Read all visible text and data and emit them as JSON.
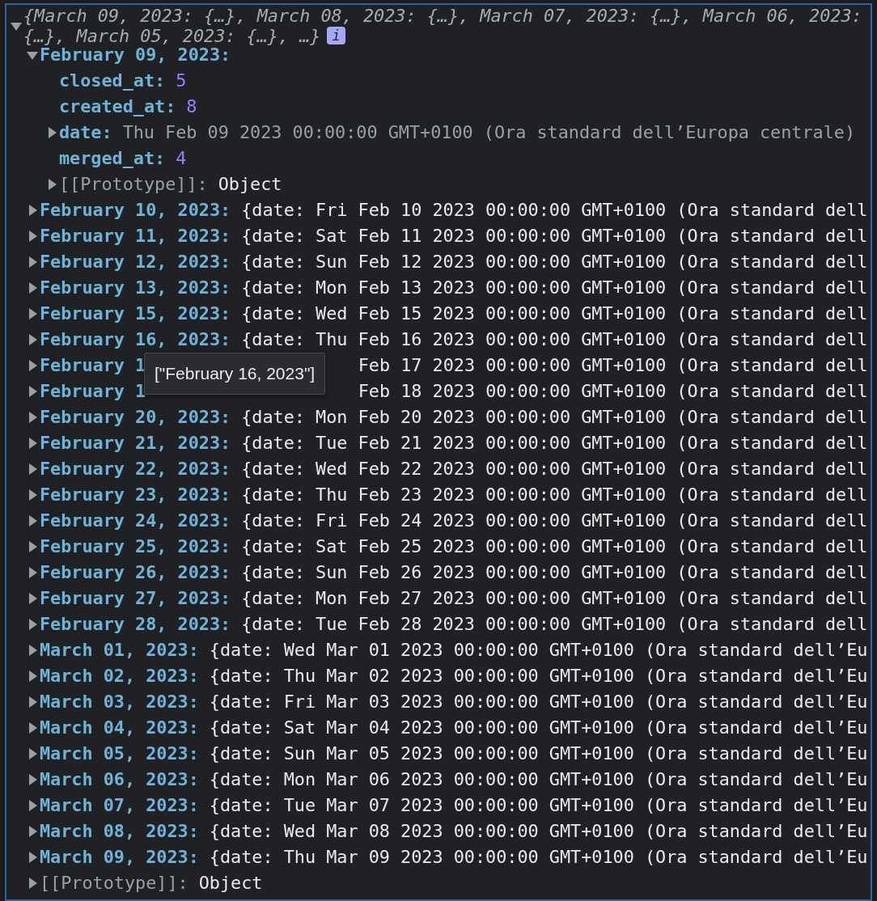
{
  "root": {
    "expanded": true,
    "summary_lines": [
      "{March 09, 2023: {…}, March 08, 2023: {…}, March 07, 2023: {…}, March 06, 2023:",
      "{…}, March 05, 2023: {…}, …}"
    ],
    "info_badge": "i",
    "children": [
      {
        "kind": "object",
        "key": "February 09, 2023:",
        "expanded": true,
        "children": [
          {
            "kind": "number",
            "key": "closed_at:",
            "value": "5"
          },
          {
            "kind": "number",
            "key": "created_at:",
            "value": "8"
          },
          {
            "kind": "date",
            "key": "date:",
            "expanded": false,
            "value": "Thu Feb 09 2023 00:00:00 GMT+0100 (Ora standard dell’Europa centrale)"
          },
          {
            "kind": "number",
            "key": "merged_at:",
            "value": "4"
          },
          {
            "kind": "prototype",
            "key": "[[Prototype]]:",
            "expanded": false,
            "value": "Object"
          }
        ]
      },
      {
        "kind": "object",
        "key": "February 10, 2023:",
        "expanded": false,
        "preview": "{date: Fri Feb 10 2023 00:00:00 GMT+0100 (Ora standard dell"
      },
      {
        "kind": "object",
        "key": "February 11, 2023:",
        "expanded": false,
        "preview": "{date: Sat Feb 11 2023 00:00:00 GMT+0100 (Ora standard dell"
      },
      {
        "kind": "object",
        "key": "February 12, 2023:",
        "expanded": false,
        "preview": "{date: Sun Feb 12 2023 00:00:00 GMT+0100 (Ora standard dell"
      },
      {
        "kind": "object",
        "key": "February 13, 2023:",
        "expanded": false,
        "preview": "{date: Mon Feb 13 2023 00:00:00 GMT+0100 (Ora standard dell"
      },
      {
        "kind": "object",
        "key": "February 15, 2023:",
        "expanded": false,
        "preview": "{date: Wed Feb 15 2023 00:00:00 GMT+0100 (Ora standard dell"
      },
      {
        "kind": "object",
        "key": "February 16, 2023:",
        "expanded": false,
        "preview": "{date: Thu Feb 16 2023 00:00:00 GMT+0100 (Ora standard dell"
      },
      {
        "kind": "object",
        "key": "February 1",
        "expanded": false,
        "under_tooltip": true,
        "preview": "Feb 17 2023 00:00:00 GMT+0100 (Ora standard dell"
      },
      {
        "kind": "object",
        "key": "February 1",
        "expanded": false,
        "under_tooltip": true,
        "preview": "Feb 18 2023 00:00:00 GMT+0100 (Ora standard dell"
      },
      {
        "kind": "object",
        "key": "February 20, 2023:",
        "expanded": false,
        "preview": "{date: Mon Feb 20 2023 00:00:00 GMT+0100 (Ora standard dell"
      },
      {
        "kind": "object",
        "key": "February 21, 2023:",
        "expanded": false,
        "preview": "{date: Tue Feb 21 2023 00:00:00 GMT+0100 (Ora standard dell"
      },
      {
        "kind": "object",
        "key": "February 22, 2023:",
        "expanded": false,
        "preview": "{date: Wed Feb 22 2023 00:00:00 GMT+0100 (Ora standard dell"
      },
      {
        "kind": "object",
        "key": "February 23, 2023:",
        "expanded": false,
        "preview": "{date: Thu Feb 23 2023 00:00:00 GMT+0100 (Ora standard dell"
      },
      {
        "kind": "object",
        "key": "February 24, 2023:",
        "expanded": false,
        "preview": "{date: Fri Feb 24 2023 00:00:00 GMT+0100 (Ora standard dell"
      },
      {
        "kind": "object",
        "key": "February 25, 2023:",
        "expanded": false,
        "preview": "{date: Sat Feb 25 2023 00:00:00 GMT+0100 (Ora standard dell"
      },
      {
        "kind": "object",
        "key": "February 26, 2023:",
        "expanded": false,
        "preview": "{date: Sun Feb 26 2023 00:00:00 GMT+0100 (Ora standard dell"
      },
      {
        "kind": "object",
        "key": "February 27, 2023:",
        "expanded": false,
        "preview": "{date: Mon Feb 27 2023 00:00:00 GMT+0100 (Ora standard dell"
      },
      {
        "kind": "object",
        "key": "February 28, 2023:",
        "expanded": false,
        "preview": "{date: Tue Feb 28 2023 00:00:00 GMT+0100 (Ora standard dell"
      },
      {
        "kind": "object",
        "key": "March 01, 2023:",
        "expanded": false,
        "preview": "{date: Wed Mar 01 2023 00:00:00 GMT+0100 (Ora standard dell’Eu"
      },
      {
        "kind": "object",
        "key": "March 02, 2023:",
        "expanded": false,
        "preview": "{date: Thu Mar 02 2023 00:00:00 GMT+0100 (Ora standard dell’Eu"
      },
      {
        "kind": "object",
        "key": "March 03, 2023:",
        "expanded": false,
        "preview": "{date: Fri Mar 03 2023 00:00:00 GMT+0100 (Ora standard dell’Eu"
      },
      {
        "kind": "object",
        "key": "March 04, 2023:",
        "expanded": false,
        "preview": "{date: Sat Mar 04 2023 00:00:00 GMT+0100 (Ora standard dell’Eu"
      },
      {
        "kind": "object",
        "key": "March 05, 2023:",
        "expanded": false,
        "preview": "{date: Sun Mar 05 2023 00:00:00 GMT+0100 (Ora standard dell’Eu"
      },
      {
        "kind": "object",
        "key": "March 06, 2023:",
        "expanded": false,
        "preview": "{date: Mon Mar 06 2023 00:00:00 GMT+0100 (Ora standard dell’Eu"
      },
      {
        "kind": "object",
        "key": "March 07, 2023:",
        "expanded": false,
        "preview": "{date: Tue Mar 07 2023 00:00:00 GMT+0100 (Ora standard dell’Eu"
      },
      {
        "kind": "object",
        "key": "March 08, 2023:",
        "expanded": false,
        "preview": "{date: Wed Mar 08 2023 00:00:00 GMT+0100 (Ora standard dell’Eu"
      },
      {
        "kind": "object",
        "key": "March 09, 2023:",
        "expanded": false,
        "preview": "{date: Thu Mar 09 2023 00:00:00 GMT+0100 (Ora standard dell’Eu"
      },
      {
        "kind": "prototype",
        "key": "[[Prototype]]:",
        "expanded": false,
        "value": "Object"
      }
    ]
  },
  "tooltip": {
    "text": "[\"February 16, 2023\"]"
  }
}
